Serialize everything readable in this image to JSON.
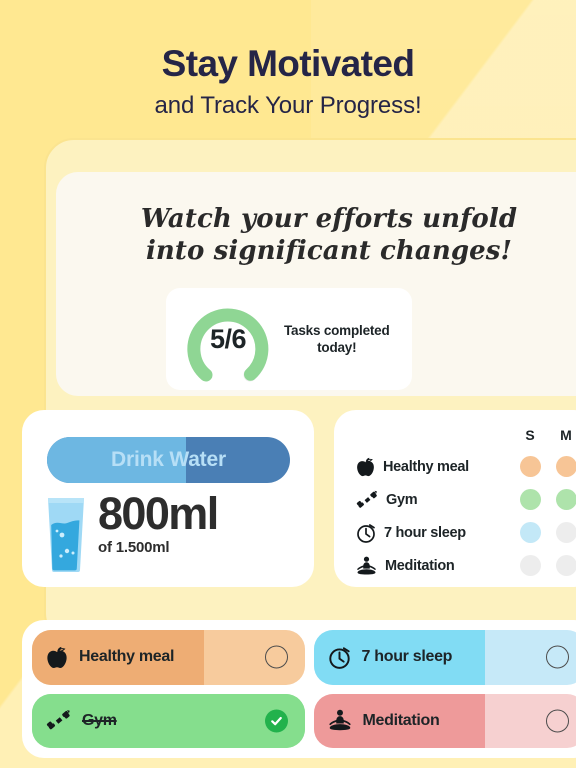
{
  "header": {
    "title": "Stay Motivated",
    "subtitle": "and Track Your Progress!"
  },
  "top_card": {
    "headline_line1": "Watch your efforts unfold",
    "headline_line2": "into significant changes!",
    "gauge": {
      "value_label": "5/6",
      "completed": 5,
      "total": 6,
      "caption_line1": "Tasks completed",
      "caption_line2": "today!",
      "fill_color": "#8fd694",
      "track_color": "#eceeed"
    }
  },
  "water_card": {
    "button_label": "Drink Water",
    "button_fill_percent": 57,
    "button_fill_color": "#6db7e2",
    "button_track_color": "#4a7fb5",
    "button_text_color": "#b7dff6",
    "amount": "800ml",
    "goal": "of 1.500ml",
    "glass_icon": "water-glass-icon"
  },
  "habit_card": {
    "columns": [
      "S",
      "M"
    ],
    "rows": [
      {
        "icon": "apple-icon",
        "label": "Healthy meal",
        "dots": [
          "#f7c596",
          "#f7c596"
        ]
      },
      {
        "icon": "dumbbell-icon",
        "label": "Gym",
        "dots": [
          "#aee3ab",
          "#aee3ab"
        ]
      },
      {
        "icon": "clock-icon",
        "label": "7 hour sleep",
        "dots": [
          "#c3e8f7",
          "#ededed"
        ]
      },
      {
        "icon": "meditation-icon",
        "label": "Meditation",
        "dots": [
          "#ededed",
          "#ededed"
        ]
      }
    ]
  },
  "chips": [
    {
      "label": "Healthy meal",
      "icon": "apple-icon",
      "fill_color": "#eead74",
      "track_color": "#f7cb9d",
      "fill_percent": 63,
      "checked": false,
      "check_state": "empty"
    },
    {
      "label": "7 hour sleep",
      "icon": "clock-icon",
      "fill_color": "#81dcf4",
      "track_color": "#c6e9f8",
      "fill_percent": 63,
      "checked": false,
      "check_state": "empty"
    },
    {
      "label": "Gym",
      "icon": "dumbbell-icon",
      "fill_color": "#85de8d",
      "track_color": "#85de8d",
      "fill_percent": 100,
      "checked": true,
      "check_state": "filled"
    },
    {
      "label": "Meditation",
      "icon": "meditation-icon",
      "fill_color": "#ee9a9a",
      "track_color": "#f6d0d0",
      "fill_percent": 63,
      "checked": false,
      "check_state": "empty"
    }
  ],
  "theme": {
    "background": "#ffe891",
    "frame": "#fdf2c0",
    "card_cream": "#fbf8ef",
    "ink": "#252547"
  }
}
